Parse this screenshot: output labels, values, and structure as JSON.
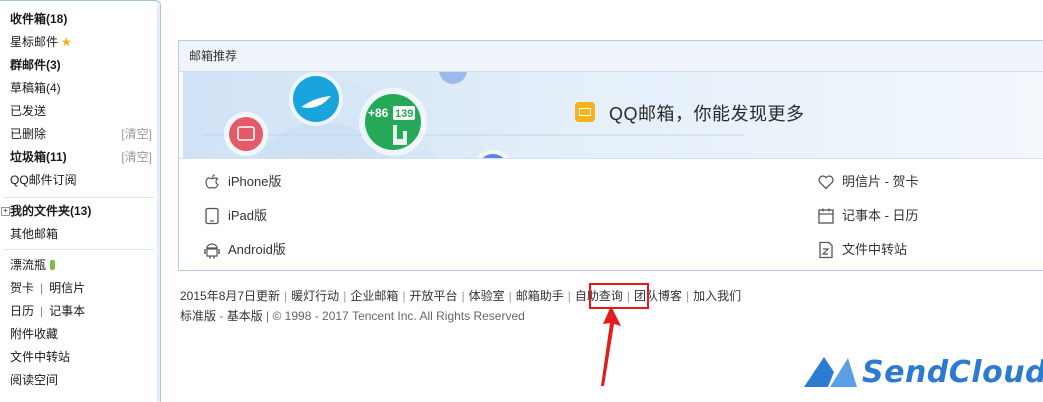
{
  "sidebar": {
    "inbox": "收件箱(18)",
    "starred": "星标邮件",
    "group_mail": "群邮件(3)",
    "drafts": "草稿箱(4)",
    "sent": "已发送",
    "deleted": "已删除",
    "deleted_clear": "[清空]",
    "spam": "垃圾箱(11)",
    "spam_clear": "[清空]",
    "subscriptions": "QQ邮件订阅",
    "my_folders": "我的文件夹(13)",
    "other_mailboxes": "其他邮箱",
    "drift_bottle": "漂流瓶",
    "greeting_card": "贺卡",
    "postcard": "明信片",
    "calendar": "日历",
    "notes": "记事本",
    "attachments": "附件收藏",
    "file_transfer": "文件中转站",
    "reading_space": "阅读空间",
    "separator": "|"
  },
  "panel": {
    "title": "邮箱推荐",
    "banner_title": "QQ邮箱，你能发现更多",
    "banner_phone": "+86",
    "banner_phone_digits": "139",
    "apps_left": [
      {
        "label": "iPhone版",
        "icon": "apple-icon"
      },
      {
        "label": "iPad版",
        "icon": "tablet-icon"
      },
      {
        "label": "Android版",
        "icon": "android-icon"
      }
    ],
    "apps_right": [
      {
        "label": "明信片 - 贺卡",
        "icon": "heart-icon"
      },
      {
        "label": "记事本 - 日历",
        "icon": "calendar-icon"
      },
      {
        "label": "文件中转站",
        "icon": "file-transfer-icon"
      }
    ]
  },
  "footer": {
    "links": [
      "2015年8月7日更新",
      "暖灯行动",
      "企业邮箱",
      "开放平台",
      "体验室",
      "邮箱助手",
      "自助查询",
      "团队博客",
      "加入我们"
    ],
    "standard": "标准版",
    "basic": "基本版",
    "copyright": "| © 1998 - 2017 Tencent Inc. All Rights Reserved",
    "dash": " - "
  },
  "watermark": {
    "text": "SendCloud"
  },
  "colors": {
    "accent": "#2d7bd1",
    "highlight": "#e41b1b",
    "panel_border": "#b7cde4"
  }
}
